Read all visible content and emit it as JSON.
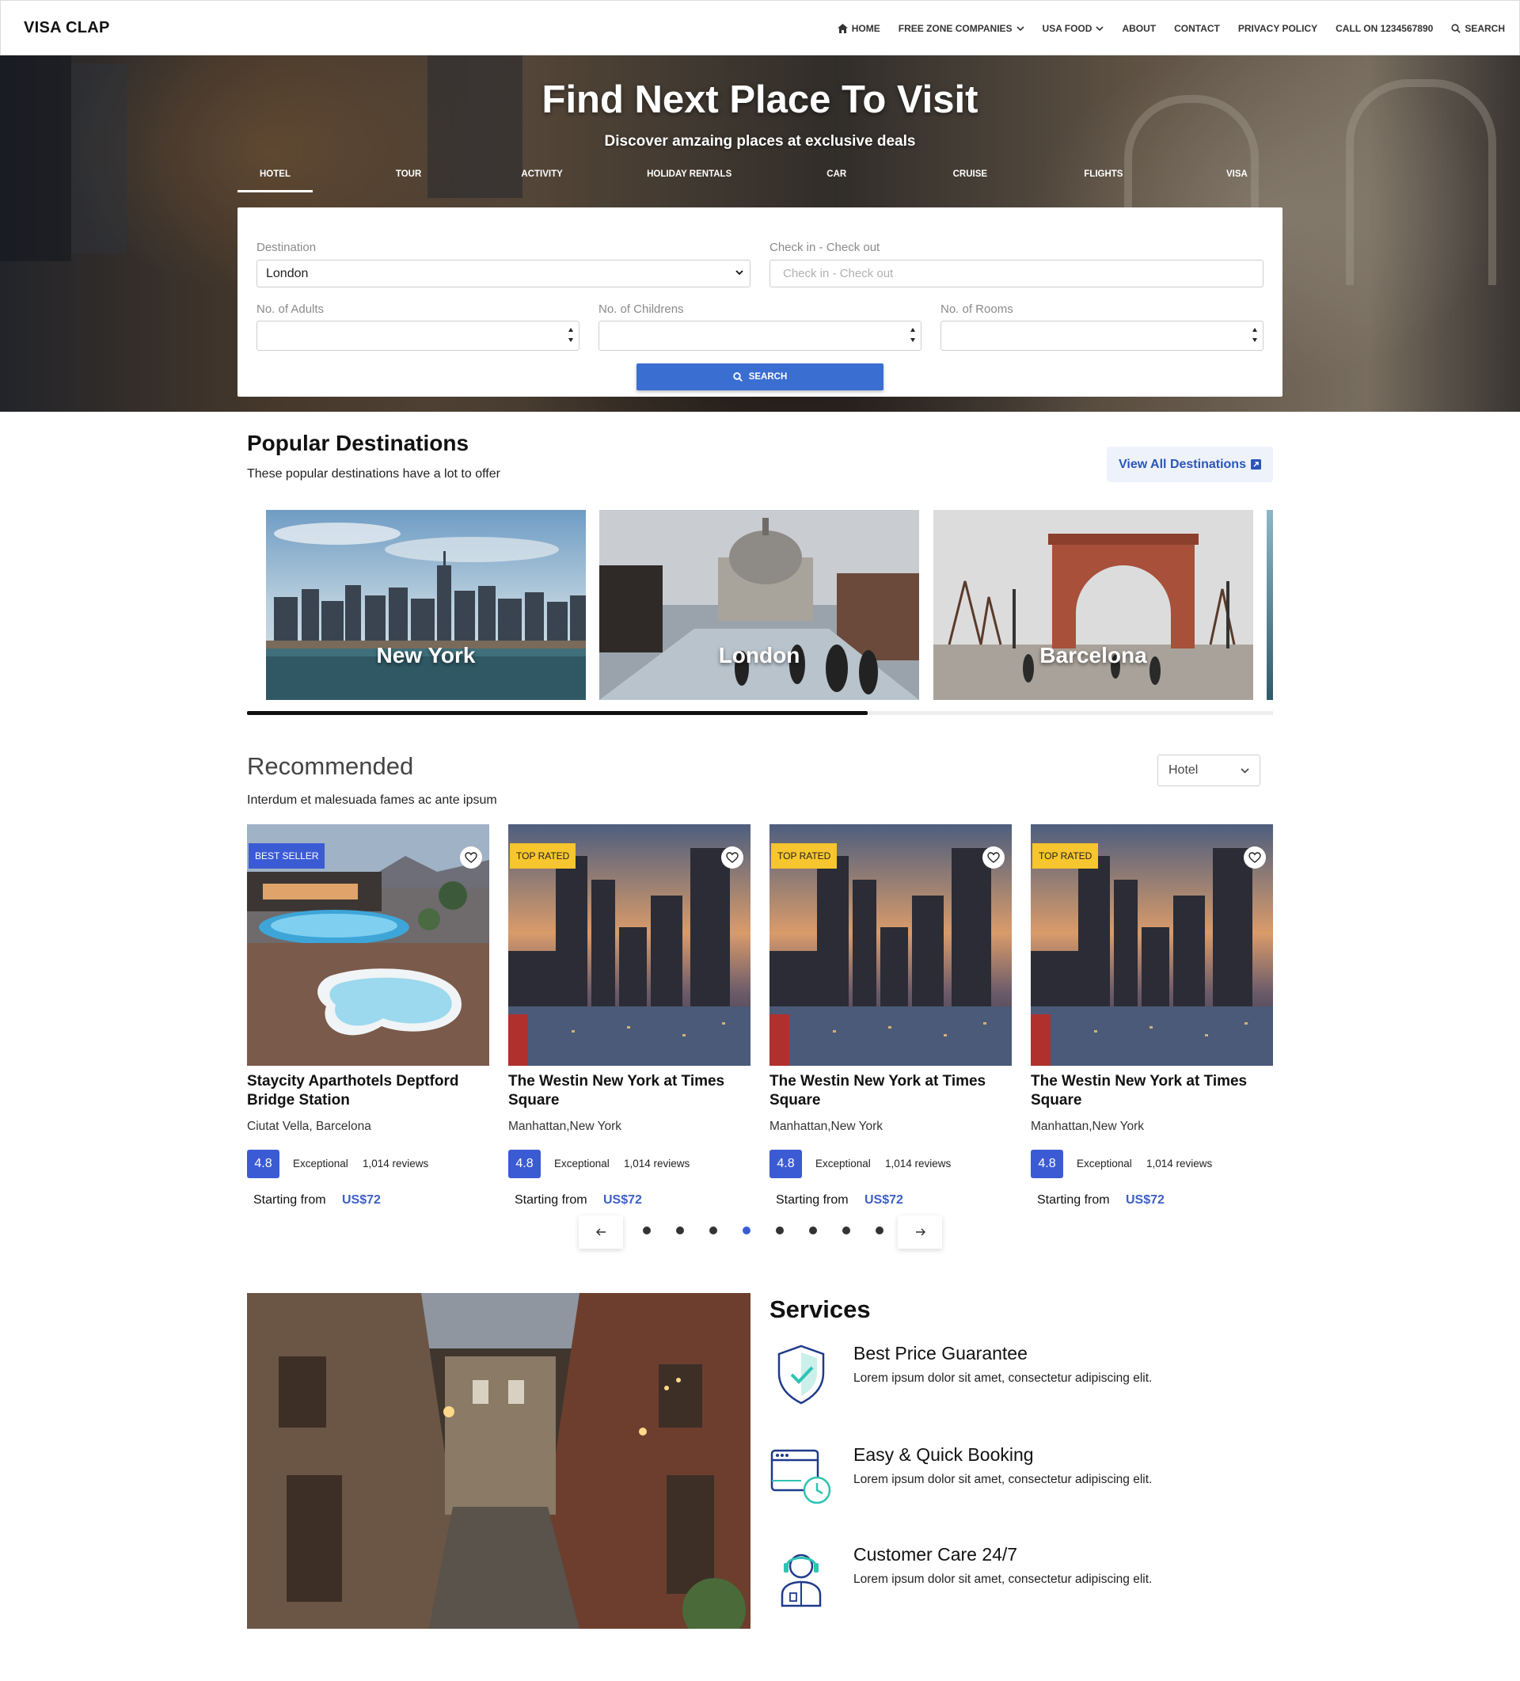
{
  "brand": "VISA CLAP",
  "nav": {
    "home": "HOME",
    "free_zone": "FREE ZONE COMPANIES",
    "usa_food": "USA FOOD",
    "about": "ABOUT",
    "contact": "CONTACT",
    "privacy": "PRIVACY POLICY",
    "call": "CALL ON 1234567890",
    "search": "SEARCH"
  },
  "hero": {
    "title": "Find Next Place To Visit",
    "subtitle": "Discover amzaing places at exclusive deals",
    "tabs": [
      "HOTEL",
      "TOUR",
      "ACTIVITY",
      "HOLIDAY RENTALS",
      "CAR",
      "CRUISE",
      "FLIGHTS",
      "VISA"
    ],
    "active_tab": "HOTEL"
  },
  "search_form": {
    "destination_label": "Destination",
    "destination_value": "London",
    "checkin_label": "Check in - Check out",
    "checkin_placeholder": "Check in - Check out",
    "adults_label": "No. of Adults",
    "children_label": "No. of Childrens",
    "rooms_label": "No. of Rooms",
    "search_button": "SEARCH"
  },
  "popular": {
    "title": "Popular Destinations",
    "subtitle": "These popular destinations have a lot to offer",
    "view_all": "View All Destinations",
    "destinations": [
      "New York",
      "London",
      "Barcelona"
    ],
    "scroll_progress": 0.605
  },
  "recommended": {
    "title": "Recommended",
    "subtitle": "Interdum et malesuada fames ac ante ipsum",
    "filter_value": "Hotel",
    "cards": [
      {
        "badge": "BEST SELLER",
        "name": "Staycity Aparthotels Deptford Bridge Station",
        "location": "Ciutat Vella, Barcelona",
        "score": "4.8",
        "rating_text": "Exceptional",
        "reviews": "1,014 reviews",
        "starting": "Starting from",
        "price": "US$72"
      },
      {
        "badge": "TOP RATED",
        "name": "The Westin New York at Times Square",
        "location": "Manhattan,New York",
        "score": "4.8",
        "rating_text": "Exceptional",
        "reviews": "1,014 reviews",
        "starting": "Starting from",
        "price": "US$72"
      },
      {
        "badge": "TOP RATED",
        "name": "The Westin New York at Times Square",
        "location": "Manhattan,New York",
        "score": "4.8",
        "rating_text": "Exceptional",
        "reviews": "1,014 reviews",
        "starting": "Starting from",
        "price": "US$72"
      },
      {
        "badge": "TOP RATED",
        "name": "The Westin New York at Times Square",
        "location": "Manhattan,New York",
        "score": "4.8",
        "rating_text": "Exceptional",
        "reviews": "1,014 reviews",
        "starting": "Starting from",
        "price": "US$72"
      }
    ],
    "pager": {
      "total_dots": 8,
      "active_dot": 4
    }
  },
  "services": {
    "title": "Services",
    "items": [
      {
        "icon": "shield-check-icon",
        "heading": "Best Price Guarantee",
        "text": "Lorem ipsum dolor sit amet, consectetur adipiscing elit."
      },
      {
        "icon": "browser-clock-icon",
        "heading": "Easy & Quick Booking",
        "text": "Lorem ipsum dolor sit amet, consectetur adipiscing elit."
      },
      {
        "icon": "headset-agent-icon",
        "heading": "Customer Care 24/7",
        "text": "Lorem ipsum dolor sit amet, consectetur adipiscing elit."
      }
    ]
  },
  "colors": {
    "accent": "#3b5bd4",
    "search_button": "#3b6ed1",
    "top_rated_badge": "#f7c52d",
    "price": "#3e5fc7",
    "icon_teal": "#2fc3b2"
  }
}
